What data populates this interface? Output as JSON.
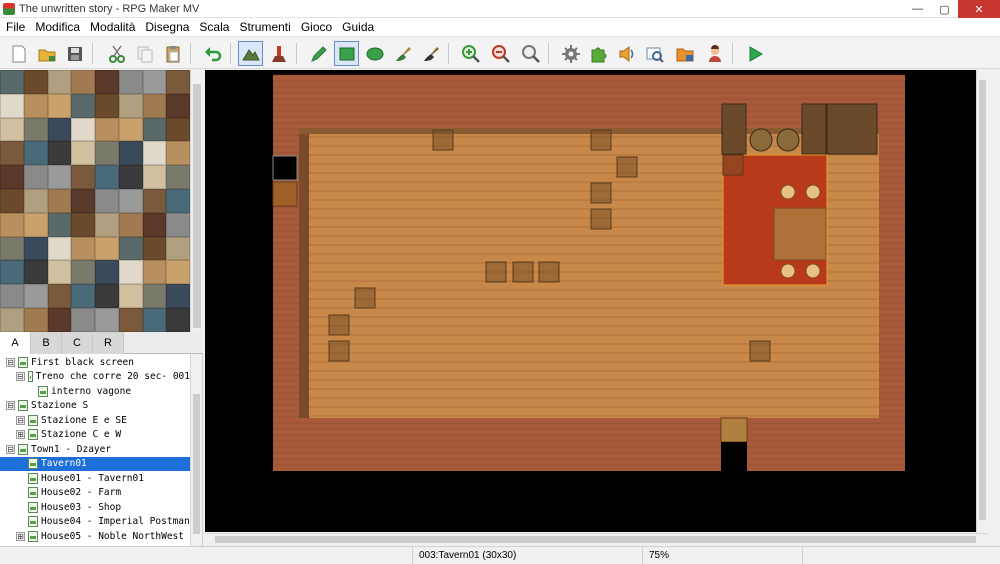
{
  "window": {
    "title": "The unwritten story - RPG Maker MV",
    "minimize": "—",
    "maximize": "▢",
    "close": "✕"
  },
  "menubar": {
    "items": [
      "File",
      "Modifica",
      "Modalità",
      "Disegna",
      "Scala",
      "Strumenti",
      "Gioco",
      "Guida"
    ]
  },
  "toolbar": {
    "buttons": [
      {
        "name": "new-project-icon",
        "color": "#ffffff"
      },
      {
        "name": "open-folder-icon",
        "color": "#e8b23a"
      },
      {
        "name": "save-icon",
        "color": "#555555"
      },
      {
        "name": "cut-icon",
        "color": "#3c8a3c"
      },
      {
        "name": "copy-icon",
        "color": "#cfcfcf"
      },
      {
        "name": "paste-icon",
        "color": "#c9a26b"
      },
      {
        "name": "undo-icon",
        "color": "#2a9a3a"
      },
      {
        "name": "map-mode-icon",
        "color": "#5a7a3a"
      },
      {
        "name": "event-mode-icon",
        "color": "#c03a2a"
      },
      {
        "name": "pencil-icon",
        "color": "#3aa04a"
      },
      {
        "name": "rectangle-icon",
        "color": "#3aa04a"
      },
      {
        "name": "ellipse-icon",
        "color": "#3aa04a"
      },
      {
        "name": "fill-icon",
        "color": "#3a7a3a"
      },
      {
        "name": "shadow-pen-icon",
        "color": "#333333"
      },
      {
        "name": "zoom-in-icon",
        "color": "#3a9a3a"
      },
      {
        "name": "zoom-out-icon",
        "color": "#c03a2a"
      },
      {
        "name": "zoom-actual-icon",
        "color": "#555555"
      },
      {
        "name": "database-icon",
        "color": "#666666"
      },
      {
        "name": "plugin-manager-icon",
        "color": "#5aaa3a"
      },
      {
        "name": "sound-test-icon",
        "color": "#e8a030"
      },
      {
        "name": "event-searcher-icon",
        "color": "#6a8aaa"
      },
      {
        "name": "resource-manager-icon",
        "color": "#e89030"
      },
      {
        "name": "character-generator-icon",
        "color": "#c04a3a"
      },
      {
        "name": "playtest-icon",
        "color": "#2aa84a"
      }
    ]
  },
  "tile_tabs": [
    "A",
    "B",
    "C",
    "R"
  ],
  "map_tree": [
    {
      "label": "First black screen",
      "level": 0,
      "expander": "⊟"
    },
    {
      "label": "Treno che corre 20 sec- 001",
      "level": 1,
      "expander": "⊟"
    },
    {
      "label": "interno vagone",
      "level": 2,
      "expander": ""
    },
    {
      "label": "Stazione S",
      "level": 0,
      "expander": "⊟"
    },
    {
      "label": "Stazione E e SE",
      "level": 1,
      "expander": "⊟"
    },
    {
      "label": "Stazione C e W",
      "level": 1,
      "expander": "⊞"
    },
    {
      "label": "Town1 - Dzayer",
      "level": 0,
      "expander": "⊟"
    },
    {
      "label": "Tavern01",
      "level": 1,
      "expander": "",
      "selected": true
    },
    {
      "label": "House01 - Tavern01",
      "level": 1,
      "expander": ""
    },
    {
      "label": "House02 - Farm",
      "level": 1,
      "expander": ""
    },
    {
      "label": "House03 - Shop",
      "level": 1,
      "expander": ""
    },
    {
      "label": "House04 - Imperial Postman",
      "level": 1,
      "expander": ""
    },
    {
      "label": "House05 - Noble NorthWest",
      "level": 1,
      "expander": "⊞"
    }
  ],
  "status": {
    "map_info": "003:Tavern01 (30x30)",
    "zoom": "75%"
  },
  "colors": {
    "selection": "#1e6fd8",
    "brick": "#a85a3a",
    "floor": "#c8884a",
    "rug": "#b83a1a"
  }
}
